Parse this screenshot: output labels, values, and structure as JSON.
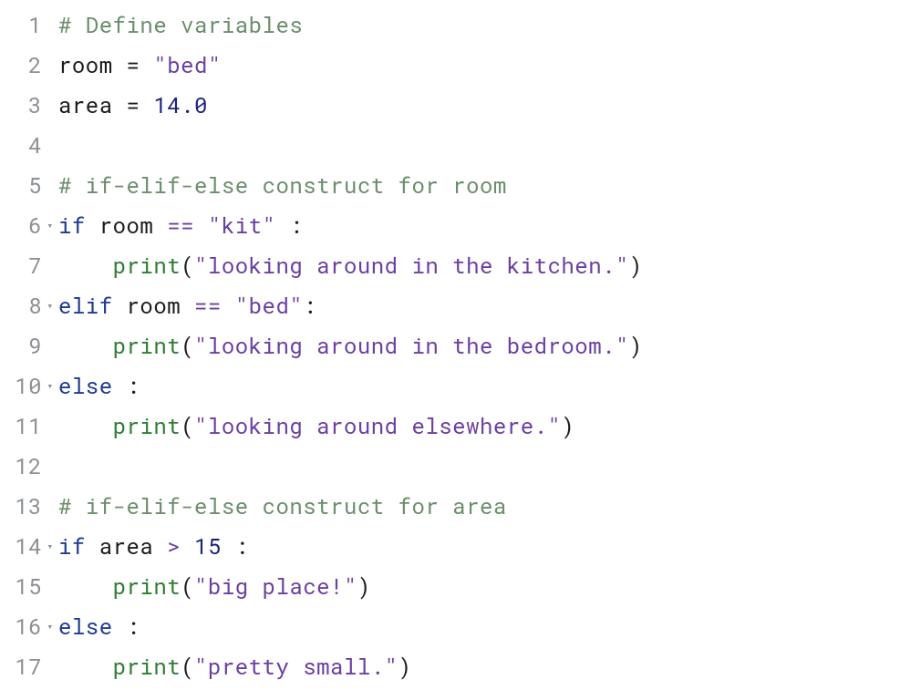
{
  "editor": {
    "language": "python",
    "tab_size": 4,
    "lines": [
      {
        "num": "1",
        "fold": "",
        "tokens": [
          {
            "cls": "tok-comment",
            "t": "# Define variables"
          }
        ]
      },
      {
        "num": "2",
        "fold": "",
        "tokens": [
          {
            "cls": "tok-ident",
            "t": "room"
          },
          {
            "cls": "",
            "t": " "
          },
          {
            "cls": "tok-assign",
            "t": "="
          },
          {
            "cls": "",
            "t": " "
          },
          {
            "cls": "tok-str",
            "t": "\"bed\""
          }
        ]
      },
      {
        "num": "3",
        "fold": "",
        "tokens": [
          {
            "cls": "tok-ident",
            "t": "area"
          },
          {
            "cls": "",
            "t": " "
          },
          {
            "cls": "tok-assign",
            "t": "="
          },
          {
            "cls": "",
            "t": " "
          },
          {
            "cls": "tok-num",
            "t": "14.0"
          }
        ]
      },
      {
        "num": "4",
        "fold": "",
        "tokens": [
          {
            "cls": "",
            "t": ""
          }
        ]
      },
      {
        "num": "5",
        "fold": "",
        "tokens": [
          {
            "cls": "tok-comment",
            "t": "# if-elif-else construct for room"
          }
        ]
      },
      {
        "num": "6",
        "fold": "▾",
        "tokens": [
          {
            "cls": "tok-kw",
            "t": "if"
          },
          {
            "cls": "",
            "t": " "
          },
          {
            "cls": "tok-ident",
            "t": "room"
          },
          {
            "cls": "",
            "t": " "
          },
          {
            "cls": "tok-op",
            "t": "=="
          },
          {
            "cls": "",
            "t": " "
          },
          {
            "cls": "tok-str",
            "t": "\"kit\""
          },
          {
            "cls": "",
            "t": " "
          },
          {
            "cls": "tok-punct",
            "t": ":"
          }
        ]
      },
      {
        "num": "7",
        "fold": "",
        "tokens": [
          {
            "cls": "",
            "t": "    "
          },
          {
            "cls": "tok-func",
            "t": "print"
          },
          {
            "cls": "tok-punct",
            "t": "("
          },
          {
            "cls": "tok-str",
            "t": "\"looking around in the kitchen.\""
          },
          {
            "cls": "tok-punct",
            "t": ")"
          }
        ]
      },
      {
        "num": "8",
        "fold": "▾",
        "tokens": [
          {
            "cls": "tok-kw",
            "t": "elif"
          },
          {
            "cls": "",
            "t": " "
          },
          {
            "cls": "tok-ident",
            "t": "room"
          },
          {
            "cls": "",
            "t": " "
          },
          {
            "cls": "tok-op",
            "t": "=="
          },
          {
            "cls": "",
            "t": " "
          },
          {
            "cls": "tok-str",
            "t": "\"bed\""
          },
          {
            "cls": "tok-punct",
            "t": ":"
          }
        ]
      },
      {
        "num": "9",
        "fold": "",
        "tokens": [
          {
            "cls": "",
            "t": "    "
          },
          {
            "cls": "tok-func",
            "t": "print"
          },
          {
            "cls": "tok-punct",
            "t": "("
          },
          {
            "cls": "tok-str",
            "t": "\"looking around in the bedroom.\""
          },
          {
            "cls": "tok-punct",
            "t": ")"
          }
        ]
      },
      {
        "num": "10",
        "fold": "▾",
        "tokens": [
          {
            "cls": "tok-kw",
            "t": "else"
          },
          {
            "cls": "",
            "t": " "
          },
          {
            "cls": "tok-punct",
            "t": ":"
          }
        ]
      },
      {
        "num": "11",
        "fold": "",
        "tokens": [
          {
            "cls": "",
            "t": "    "
          },
          {
            "cls": "tok-func",
            "t": "print"
          },
          {
            "cls": "tok-punct",
            "t": "("
          },
          {
            "cls": "tok-str",
            "t": "\"looking around elsewhere.\""
          },
          {
            "cls": "tok-punct",
            "t": ")"
          }
        ]
      },
      {
        "num": "12",
        "fold": "",
        "tokens": [
          {
            "cls": "",
            "t": ""
          }
        ]
      },
      {
        "num": "13",
        "fold": "",
        "tokens": [
          {
            "cls": "tok-comment",
            "t": "# if-elif-else construct for area"
          }
        ]
      },
      {
        "num": "14",
        "fold": "▾",
        "tokens": [
          {
            "cls": "tok-kw",
            "t": "if"
          },
          {
            "cls": "",
            "t": " "
          },
          {
            "cls": "tok-ident",
            "t": "area"
          },
          {
            "cls": "",
            "t": " "
          },
          {
            "cls": "tok-op",
            "t": ">"
          },
          {
            "cls": "",
            "t": " "
          },
          {
            "cls": "tok-num",
            "t": "15"
          },
          {
            "cls": "",
            "t": " "
          },
          {
            "cls": "tok-punct",
            "t": ":"
          }
        ]
      },
      {
        "num": "15",
        "fold": "",
        "tokens": [
          {
            "cls": "",
            "t": "    "
          },
          {
            "cls": "tok-func",
            "t": "print"
          },
          {
            "cls": "tok-punct",
            "t": "("
          },
          {
            "cls": "tok-str",
            "t": "\"big place!\""
          },
          {
            "cls": "tok-punct",
            "t": ")"
          }
        ]
      },
      {
        "num": "16",
        "fold": "▾",
        "tokens": [
          {
            "cls": "tok-kw",
            "t": "else"
          },
          {
            "cls": "",
            "t": " "
          },
          {
            "cls": "tok-punct",
            "t": ":"
          }
        ]
      },
      {
        "num": "17",
        "fold": "",
        "tokens": [
          {
            "cls": "",
            "t": "    "
          },
          {
            "cls": "tok-func",
            "t": "print"
          },
          {
            "cls": "tok-punct",
            "t": "("
          },
          {
            "cls": "tok-str",
            "t": "\"pretty small.\""
          },
          {
            "cls": "tok-punct",
            "t": ")"
          }
        ]
      }
    ]
  }
}
